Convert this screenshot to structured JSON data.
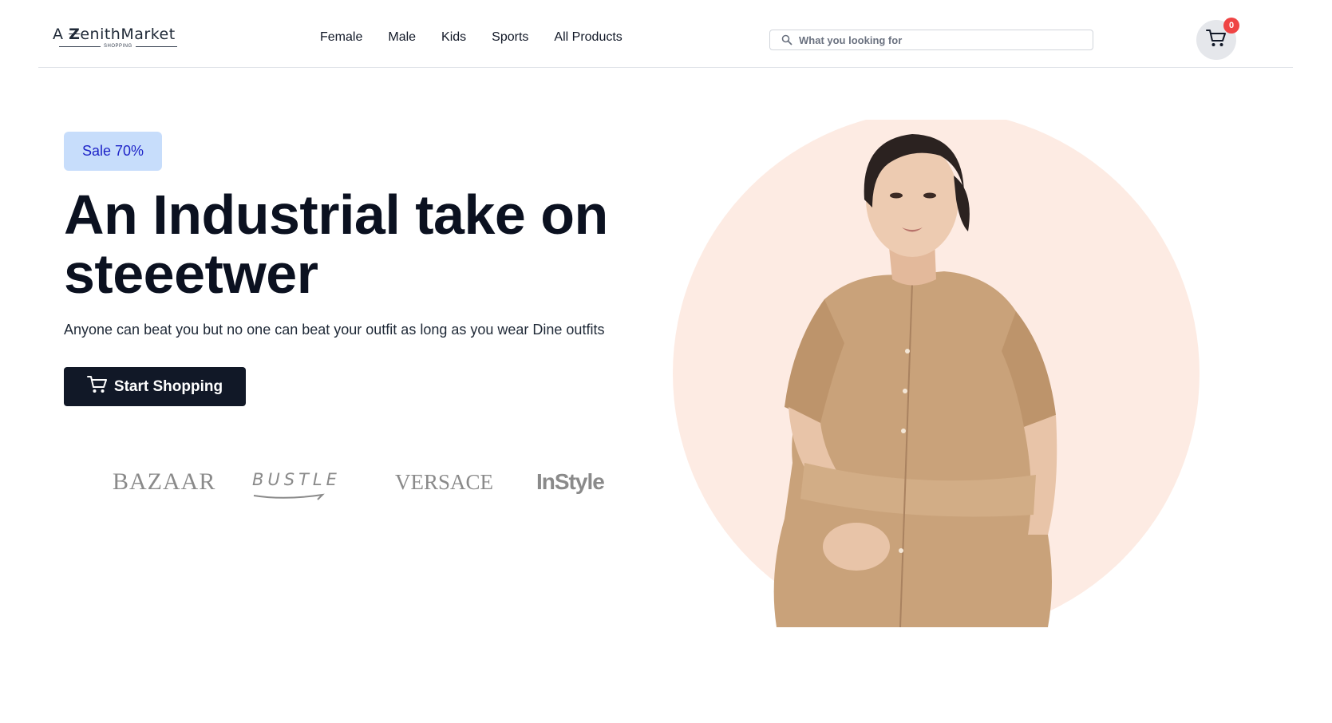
{
  "header": {
    "logo": {
      "prefix": "A",
      "z": "Z",
      "name": "enithMarket",
      "tagline": "SHOPPING"
    },
    "nav": [
      "Female",
      "Male",
      "Kids",
      "Sports",
      "All Products"
    ],
    "search": {
      "placeholder": "What you looking for",
      "value": ""
    },
    "cart": {
      "count": "0"
    }
  },
  "hero": {
    "badge": "Sale 70%",
    "title_line1": "An Industrial take on",
    "title_line2": "steeetwer",
    "subtitle": "Anyone can beat you but no one can beat your outfit as long as you wear Dine outfits",
    "cta_label": "Start Shopping"
  },
  "brands": [
    "BAZAAR",
    "BUSTLE",
    "VERSACE",
    "InStyle"
  ],
  "colors": {
    "accent_dark": "#111827",
    "badge_bg": "#c7ddfb",
    "badge_text": "#1e24c8",
    "circle_bg": "#fdebe3",
    "dress": "#c9a27a",
    "cart_badge": "#ef4444"
  },
  "icons": {
    "search": "search-icon",
    "cart": "cart-icon",
    "cta": "cart-icon"
  }
}
